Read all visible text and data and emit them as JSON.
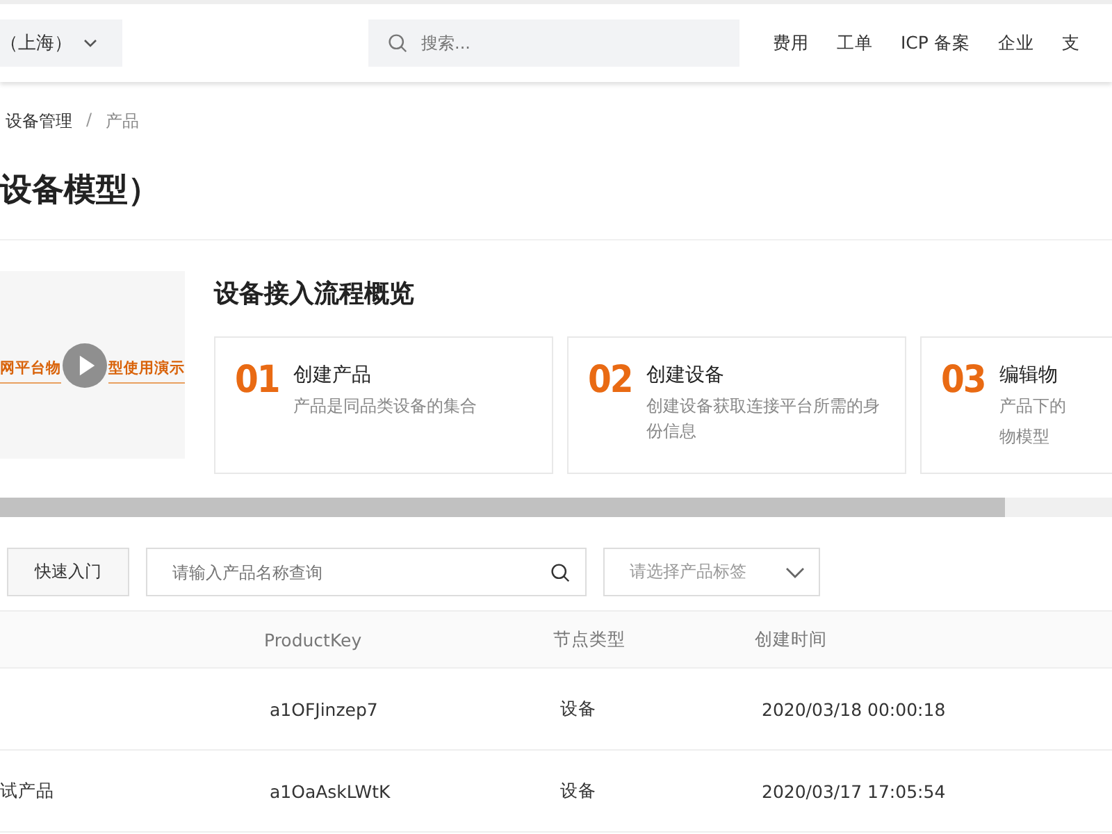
{
  "top_bar": {
    "region": "（上海）",
    "search": {
      "placeholder": "搜索..."
    },
    "nav": [
      {
        "label": "费用"
      },
      {
        "label": "工单"
      },
      {
        "label": "ICP 备案"
      },
      {
        "label": "企业"
      },
      {
        "label": "支"
      }
    ]
  },
  "breadcrumb": {
    "items": [
      "设备管理",
      "产品"
    ],
    "separator": "/"
  },
  "page_title": "设备模型）",
  "video": {
    "caption_before": "网平台物",
    "caption_after": "型使用演示"
  },
  "overview": {
    "title": "设备接入流程概览",
    "steps": [
      {
        "number": "01",
        "title": "创建产品",
        "description": "产品是同品类设备的集合"
      },
      {
        "number": "02",
        "title": "创建设备",
        "description": "创建设备获取连接平台所需的身份信息"
      },
      {
        "number": "03",
        "title": "编辑物",
        "description": "产品下的",
        "description_2": "物模型"
      }
    ]
  },
  "toolbar": {
    "quick_start": "快速入门",
    "search": {
      "placeholder": "请输入产品名称查询"
    },
    "tag_select": {
      "placeholder": "请选择产品标签"
    }
  },
  "table": {
    "columns": [
      "ProductKey",
      "节点类型",
      "创建时间"
    ],
    "rows": [
      {
        "name": "",
        "product_key": "a1OFJinzep7",
        "node_type": "设备",
        "created": "2020/03/18 00:00:18"
      },
      {
        "name": "试产品",
        "product_key": "a1OaAskLWtK",
        "node_type": "设备",
        "created": "2020/03/17 17:05:54"
      }
    ]
  }
}
